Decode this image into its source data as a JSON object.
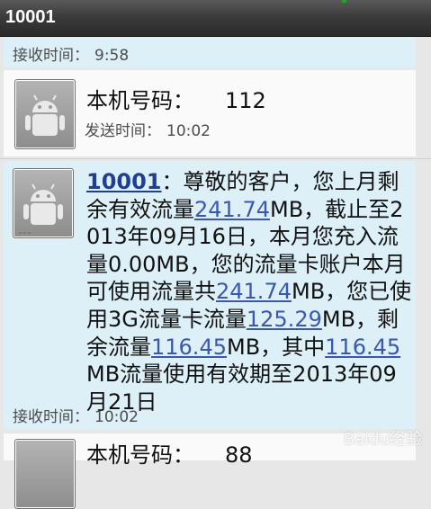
{
  "header": {
    "title": "10001"
  },
  "messages": [
    {
      "type": "received",
      "time_label": "接收时间：",
      "time": "9:58"
    },
    {
      "type": "sent",
      "name": "本机号码：",
      "number": "112",
      "time_label": "发送时间：",
      "time": "10:02"
    },
    {
      "type": "received",
      "sender": "10001",
      "parts": [
        "：尊敬的客户，您上月剩余有效流量",
        "241.74",
        "MB，截止至2013年09月16日，本月您充入流量0.00MB，您的流量卡账户本月可使用流量共",
        "241.74",
        "MB，您已使用3G流量卡流量",
        "125.29",
        "MB，剩余流量",
        "116.45",
        "MB，其中",
        "116.45",
        "MB流量使用有效期至2013年09月21日"
      ],
      "time_label": "接收时间：",
      "time": "10:02"
    },
    {
      "type": "sent",
      "name": "本机号码：",
      "number": "88"
    }
  ],
  "watermark": "Baidu经验"
}
